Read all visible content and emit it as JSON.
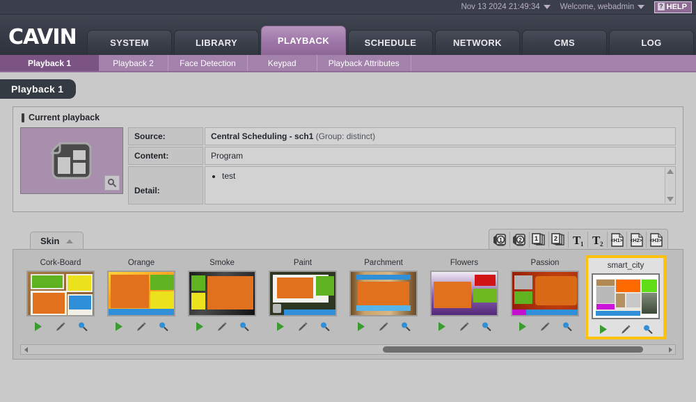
{
  "topbar": {
    "datetime": "Nov 13 2024 21:49:34",
    "welcome": "Welcome, webadmin",
    "help_label": "HELP",
    "help_q": "?"
  },
  "brand": {
    "logo_text": "CAVIN"
  },
  "nav": {
    "tabs": [
      {
        "label": "SYSTEM",
        "active": false
      },
      {
        "label": "LIBRARY",
        "active": false
      },
      {
        "label": "PLAYBACK",
        "active": true
      },
      {
        "label": "SCHEDULE",
        "active": false
      },
      {
        "label": "NETWORK",
        "active": false
      },
      {
        "label": "CMS",
        "active": false
      },
      {
        "label": "LOG",
        "active": false
      }
    ]
  },
  "subnav": {
    "items": [
      {
        "label": "Playback 1",
        "active": true
      },
      {
        "label": "Playback 2",
        "active": false
      },
      {
        "label": "Face Detection",
        "active": false
      },
      {
        "label": "Keypad",
        "active": false
      },
      {
        "label": "Playback Attributes",
        "active": false
      }
    ]
  },
  "page": {
    "title": "Playback 1"
  },
  "current_playback": {
    "heading": "Current playback",
    "rows": [
      {
        "label": "Source:",
        "value_strong": "Central Scheduling - sch1",
        "value_muted": "(Group: distinct)"
      },
      {
        "label": "Content:",
        "value_strong": "",
        "value_muted": "Program"
      }
    ],
    "detail_label": "Detail:",
    "detail_items": [
      "test"
    ]
  },
  "skin_section": {
    "tab_label": "Skin",
    "toolbar_icons": [
      {
        "name": "video-1-icon",
        "glyph": "1",
        "kind": "camera"
      },
      {
        "name": "video-2-icon",
        "glyph": "2",
        "kind": "camera"
      },
      {
        "name": "pages-1-icon",
        "glyph": "1",
        "kind": "stack"
      },
      {
        "name": "pages-2-icon",
        "glyph": "2",
        "kind": "stack"
      },
      {
        "name": "ticker-t1-icon",
        "glyph": "1",
        "kind": "text"
      },
      {
        "name": "ticker-t2-icon",
        "glyph": "2",
        "kind": "text"
      },
      {
        "name": "html-h1-icon",
        "glyph": "H1",
        "kind": "page"
      },
      {
        "name": "html-h2-icon",
        "glyph": "H2",
        "kind": "page"
      },
      {
        "name": "html-h3-icon",
        "glyph": "H3",
        "kind": "page"
      }
    ],
    "action_labels": {
      "play": "play-icon",
      "edit": "edit-icon",
      "preview": "preview-icon"
    },
    "selected_skin": "smart_city",
    "accent_selected": "#ffc20a",
    "skins": [
      {
        "name": "Cork-Board",
        "selected": false
      },
      {
        "name": "Orange",
        "selected": false
      },
      {
        "name": "Smoke",
        "selected": false
      },
      {
        "name": "Paint",
        "selected": false
      },
      {
        "name": "Parchment",
        "selected": false
      },
      {
        "name": "Flowers",
        "selected": false
      },
      {
        "name": "Passion",
        "selected": false
      },
      {
        "name": "smart_city",
        "selected": true
      }
    ]
  },
  "colors": {
    "nav_dark": "#383d48",
    "accent_purple": "#9d76a7",
    "subnav": "#a281ab",
    "page_bg": "#c9c9c9",
    "selected_gold": "#ffc20a"
  }
}
